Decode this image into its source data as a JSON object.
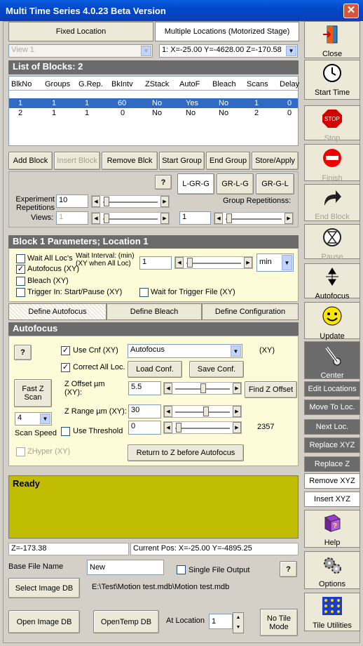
{
  "window": {
    "title": "Multi Time Series 4.0.23 Beta Version",
    "close_symbol": "✕"
  },
  "top_tabs": {
    "fixed": "Fixed Location",
    "multiple": "Multiple Locations (Motorized Stage)"
  },
  "view_combo": "View 1",
  "location_combo": "1: X=-25.00 Y=-4628.00 Z=-170.58",
  "blocks": {
    "title": "List of Blocks: 2",
    "columns": [
      "BlkNo",
      "Groups",
      "G.Rep.",
      "BkIntv",
      "ZStack",
      "AutoF",
      "Bleach",
      "Scans",
      "Delay"
    ],
    "rows": [
      [
        "1",
        "1",
        "1",
        "60",
        "No",
        "Yes",
        "No",
        "1",
        "0"
      ],
      [
        "2",
        "1",
        "1",
        "0",
        "No",
        "No",
        "No",
        "2",
        "0"
      ]
    ],
    "buttons": {
      "add": "Add Block",
      "insert": "Insert Block",
      "remove": "Remove Blck",
      "start_group": "Start Group",
      "end_group": "End Group",
      "store": "Store/Apply"
    }
  },
  "repetitions": {
    "help": "?",
    "order_buttons": [
      "L-GR-G",
      "GR-L-G",
      "GR-G-L"
    ],
    "experiment_label": "Experiment Repetitions",
    "experiment_value": "10",
    "views_label": "Views:",
    "views_value": "1",
    "group_label": "Group Repetitionss:",
    "group_value": "1"
  },
  "block_params": {
    "title": "Block 1 Parameters; Location 1",
    "wait_all": "Wait All Loc's",
    "wait_interval_label": "Wait Interval: (min) (XY when All Loc)",
    "wait_interval_value": "1",
    "unit": "min",
    "autofocus_xy": "Autofocus (XY)",
    "bleach_xy": "Bleach (XY)",
    "trigger": "Trigger In: Start/Pause (XY)",
    "wait_trigger": "Wait for Trigger File (XY)",
    "tabs": [
      "Define Autofocus",
      "Define Bleach",
      "Define Configuration"
    ]
  },
  "autofocus": {
    "title": "Autofocus",
    "help": "?",
    "use_cnf": "Use Cnf (XY)",
    "config_combo": "Autofocus",
    "xy_note": "(XY)",
    "correct_all": "Correct All Loc.",
    "load_conf": "Load Conf.",
    "save_conf": "Save Conf.",
    "fast_z": "Fast Z Scan",
    "z_offset_label": "Z Offset µm (XY):",
    "z_offset_value": "5.5",
    "find_z": "Find Z Offset",
    "scan_speed_value": "4",
    "scan_speed_label": "Scan Speed",
    "z_range_label": "Z Range µm (XY):",
    "z_range_value": "30",
    "use_threshold": "Use Threshold",
    "threshold_value": "0",
    "threshold_readout": "2357",
    "zhyper": "ZHyper (XY)",
    "return_z": "Return to Z before Autofocus"
  },
  "status": {
    "text": "Ready",
    "z": "Z=-173.38",
    "current_pos": "Current Pos: X=-25.00 Y=-4895.25"
  },
  "file": {
    "base_label": "Base File Name",
    "base_value": "New",
    "single_output": "Single File Output",
    "help": "?",
    "select_db": "Select Image DB",
    "db_path": "E:\\Test\\Motion test.mdb\\Motion test.mdb",
    "open_db": "Open Image DB",
    "open_temp": "OpenTemp DB",
    "at_location_label": "At Location",
    "at_location_value": "1",
    "no_tile": "No Tile Mode"
  },
  "sidebar": {
    "close": "Close",
    "start_time": "Start Time",
    "stop": "Stop",
    "finish": "Finish",
    "end_block": "End Block",
    "pause": "Pause",
    "autofocus": "Autofocus",
    "update": "Update",
    "center": "Center",
    "edit_locations": "Edit Locations",
    "move_to_loc": "Move To Loc.",
    "next_loc": "Next Loc.",
    "replace_xyz": "Replace XYZ",
    "replace_z": "Replace Z",
    "remove_xyz": "Remove XYZ",
    "insert_xyz": "Insert XYZ",
    "help": "Help",
    "options": "Options",
    "tile": "Tile Utilities"
  },
  "colors": {
    "accent_selection": "#316ac5",
    "status_bg": "#c0bd00",
    "panel_bg": "#fdfbd8",
    "header_bg": "#6b6b6b"
  }
}
